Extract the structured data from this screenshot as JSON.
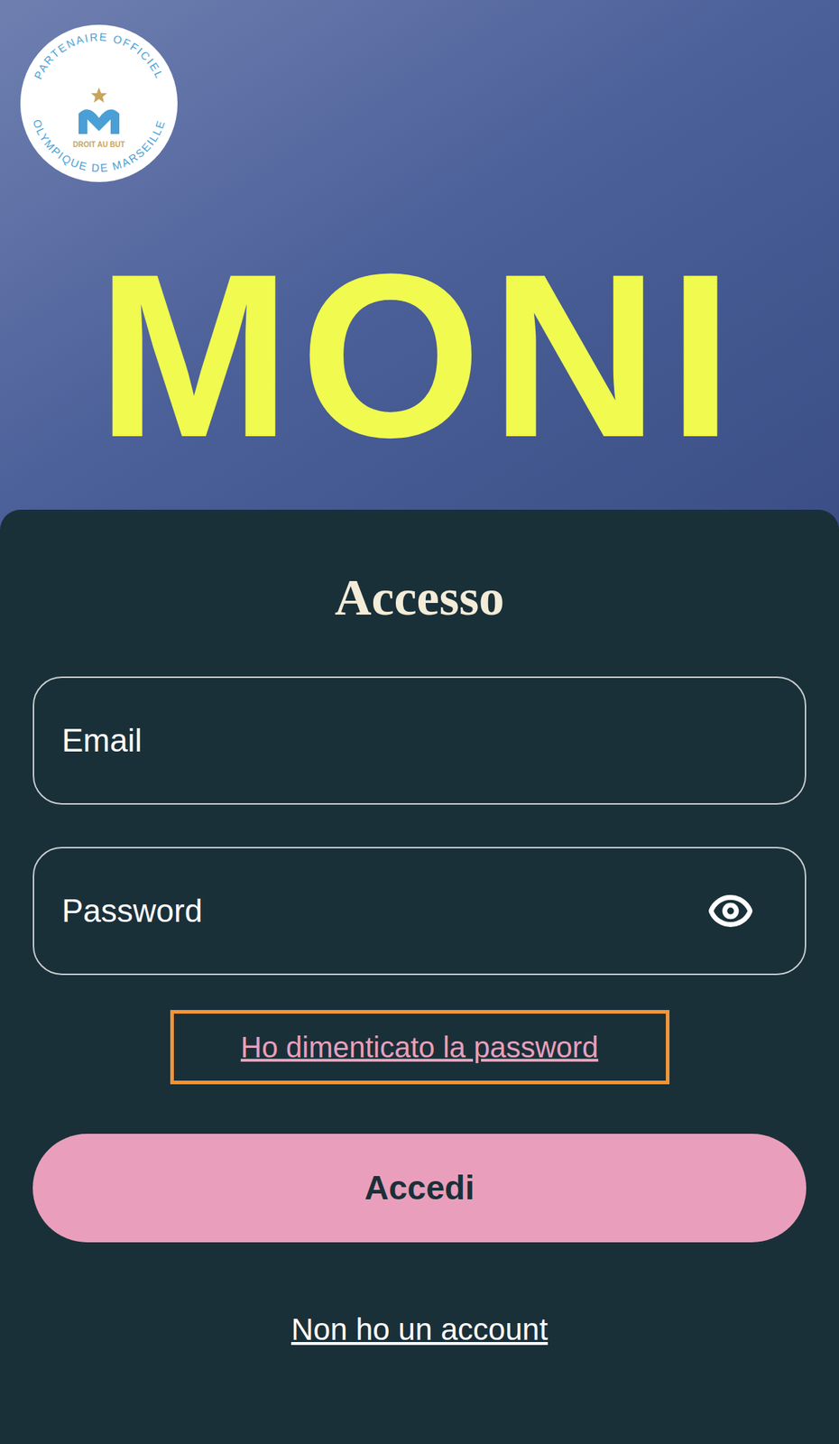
{
  "badge": {
    "top_text": "PARTENAIRE OFFICIEL",
    "bottom_text": "OLYMPIQUE DE MARSEILLE",
    "motto": "DROIT AU BUT"
  },
  "logo": "MONI",
  "form": {
    "title": "Accesso",
    "fields": [
      {
        "placeholder": "Email",
        "kind": "email"
      },
      {
        "placeholder": "Password",
        "kind": "password"
      }
    ],
    "forgot_link": {
      "label": "Ho dimenticato la password",
      "highlighted": true
    },
    "submit": "Accedi",
    "signup_link": "Non ho un account"
  }
}
